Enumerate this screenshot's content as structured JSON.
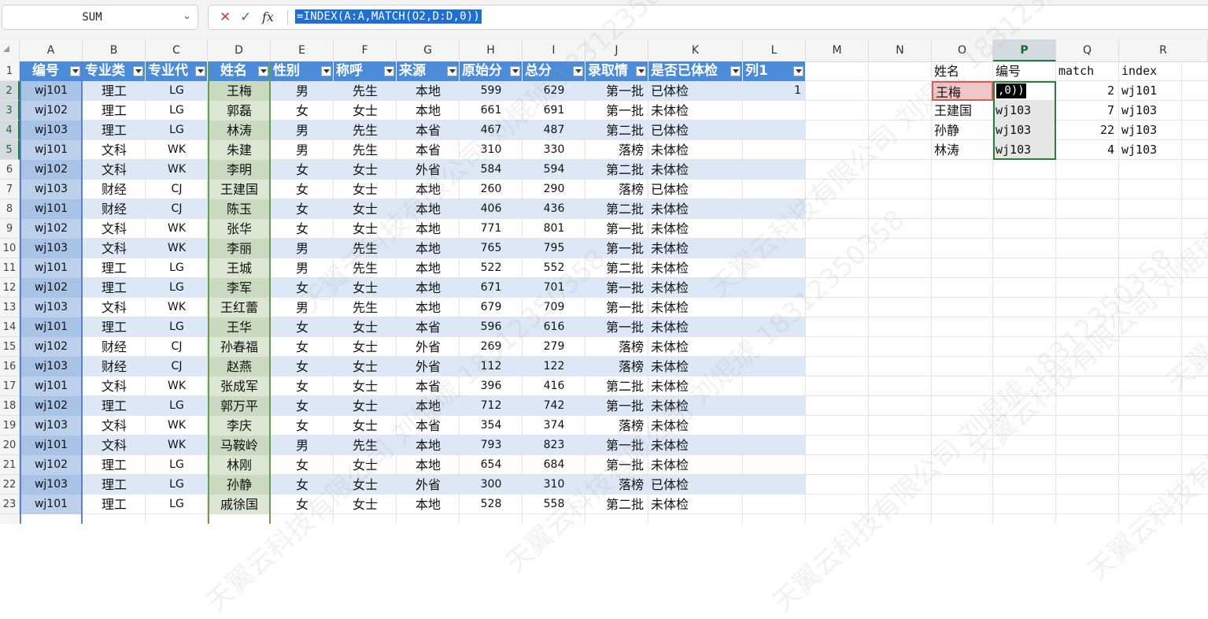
{
  "formula_bar": {
    "name_box": "SUM",
    "formula": "=INDEX(A:A,MATCH(O2,D:D,0))"
  },
  "columns": [
    "A",
    "B",
    "C",
    "D",
    "E",
    "F",
    "G",
    "H",
    "I",
    "J",
    "K",
    "L",
    "M",
    "N",
    "O",
    "P",
    "Q",
    "R"
  ],
  "selected_column": "P",
  "rows": [
    "1",
    "2",
    "3",
    "4",
    "5",
    "6",
    "7",
    "8",
    "9",
    "10",
    "11",
    "12",
    "13",
    "14",
    "15",
    "16",
    "17",
    "18",
    "19",
    "20",
    "21",
    "22",
    "23"
  ],
  "selected_rows": [
    "2",
    "3",
    "4",
    "5"
  ],
  "table": {
    "headers": [
      "编号",
      "专业类",
      "专业代",
      "姓名",
      "性别",
      "称呼",
      "来源",
      "原始分",
      "总分",
      "录取情",
      "是否已体检",
      "列1"
    ],
    "rows": [
      [
        "wj101",
        "理工",
        "LG",
        "王梅",
        "男",
        "先生",
        "本地",
        "599",
        "629",
        "第一批",
        "已体检",
        "1"
      ],
      [
        "wj102",
        "理工",
        "LG",
        "郭磊",
        "女",
        "女士",
        "本地",
        "661",
        "691",
        "第一批",
        "未体检",
        ""
      ],
      [
        "wj103",
        "理工",
        "LG",
        "林涛",
        "男",
        "先生",
        "本省",
        "467",
        "487",
        "第二批",
        "已体检",
        ""
      ],
      [
        "wj101",
        "文科",
        "WK",
        "朱建",
        "男",
        "先生",
        "本省",
        "310",
        "330",
        "落榜",
        "未体检",
        ""
      ],
      [
        "wj102",
        "文科",
        "WK",
        "李明",
        "女",
        "女士",
        "外省",
        "584",
        "594",
        "第二批",
        "未体检",
        ""
      ],
      [
        "wj103",
        "财经",
        "CJ",
        "王建国",
        "女",
        "女士",
        "本地",
        "260",
        "290",
        "落榜",
        "已体检",
        ""
      ],
      [
        "wj101",
        "财经",
        "CJ",
        "陈玉",
        "女",
        "女士",
        "本地",
        "406",
        "436",
        "第二批",
        "未体检",
        ""
      ],
      [
        "wj102",
        "文科",
        "WK",
        "张华",
        "女",
        "女士",
        "本地",
        "771",
        "801",
        "第一批",
        "未体检",
        ""
      ],
      [
        "wj103",
        "文科",
        "WK",
        "李丽",
        "男",
        "先生",
        "本地",
        "765",
        "795",
        "第一批",
        "未体检",
        ""
      ],
      [
        "wj101",
        "理工",
        "LG",
        "王城",
        "男",
        "先生",
        "本地",
        "522",
        "552",
        "第二批",
        "未体检",
        ""
      ],
      [
        "wj102",
        "理工",
        "LG",
        "李军",
        "女",
        "女士",
        "本地",
        "671",
        "701",
        "第一批",
        "未体检",
        ""
      ],
      [
        "wj103",
        "文科",
        "WK",
        "王红蕾",
        "男",
        "先生",
        "本地",
        "679",
        "709",
        "第一批",
        "未体检",
        ""
      ],
      [
        "wj101",
        "理工",
        "LG",
        "王华",
        "女",
        "女士",
        "本省",
        "596",
        "616",
        "第一批",
        "未体检",
        ""
      ],
      [
        "wj102",
        "财经",
        "CJ",
        "孙春福",
        "女",
        "女士",
        "外省",
        "269",
        "279",
        "落榜",
        "未体检",
        ""
      ],
      [
        "wj103",
        "财经",
        "CJ",
        "赵燕",
        "女",
        "女士",
        "外省",
        "112",
        "122",
        "落榜",
        "未体检",
        ""
      ],
      [
        "wj101",
        "文科",
        "WK",
        "张成军",
        "女",
        "女士",
        "本省",
        "396",
        "416",
        "第二批",
        "未体检",
        ""
      ],
      [
        "wj102",
        "理工",
        "LG",
        "郭万平",
        "女",
        "女士",
        "本地",
        "712",
        "742",
        "第一批",
        "未体检",
        ""
      ],
      [
        "wj103",
        "文科",
        "WK",
        "李庆",
        "女",
        "女士",
        "本省",
        "354",
        "374",
        "落榜",
        "未体检",
        ""
      ],
      [
        "wj101",
        "文科",
        "WK",
        "马鞍岭",
        "男",
        "先生",
        "本地",
        "793",
        "823",
        "第一批",
        "未体检",
        ""
      ],
      [
        "wj102",
        "理工",
        "LG",
        "林刚",
        "女",
        "女士",
        "本地",
        "654",
        "684",
        "第一批",
        "未体检",
        ""
      ],
      [
        "wj103",
        "理工",
        "LG",
        "孙静",
        "女",
        "女士",
        "外省",
        "300",
        "310",
        "落榜",
        "已体检",
        ""
      ],
      [
        "wj101",
        "理工",
        "LG",
        "戚徐国",
        "女",
        "女士",
        "本地",
        "528",
        "558",
        "第二批",
        "未体检",
        ""
      ]
    ]
  },
  "lookup": {
    "headers": [
      "姓名",
      "编号",
      "match",
      "index"
    ],
    "rows": [
      [
        "王梅",
        ",0))",
        "2",
        "wj101"
      ],
      [
        "王建国",
        "wj103",
        "7",
        "wj103"
      ],
      [
        "孙静",
        "wj103",
        "22",
        "wj103"
      ],
      [
        "林涛",
        "wj103",
        "4",
        "wj103"
      ]
    ]
  },
  "watermark": "天翼云科技有限公司 刘焜琥 18312350358",
  "colors": {
    "table_header": "#4b8bd8",
    "band": "#dce8f6",
    "ref_red": "#d25a5a",
    "selection_green": "#2d7d3a",
    "formula_highlight": "#1e6fd1"
  }
}
